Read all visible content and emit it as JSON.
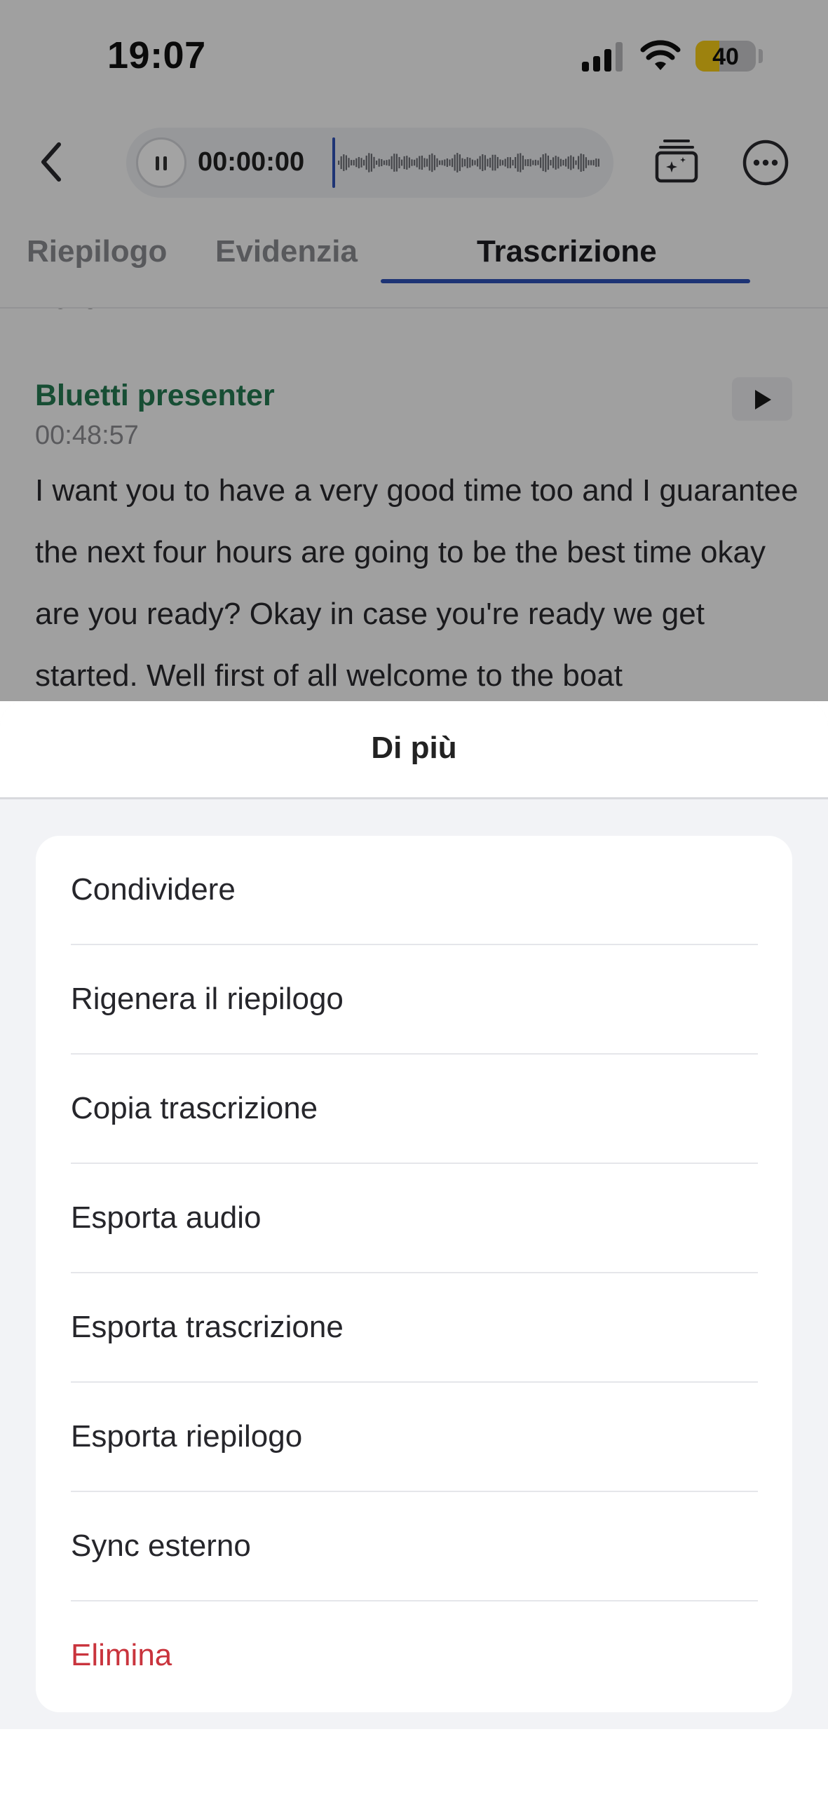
{
  "status_bar": {
    "time": "19:07",
    "battery_percent": "40",
    "battery_color": "#f6cc16"
  },
  "player": {
    "time": "00:00:00",
    "accent_color": "#2f52b8"
  },
  "tabs": [
    {
      "label": "Riepilogo",
      "selected": false
    },
    {
      "label": "Evidenzia",
      "selected": false
    },
    {
      "label": "Trascrizione",
      "selected": true
    }
  ],
  "transcript": {
    "previous_line": "hello.",
    "segment": {
      "speaker": "Bluetti presenter",
      "speaker_color": "#257a52",
      "timestamp": "00:48:57",
      "text": "I want you to have a very good time too and I guarantee the next four hours are going to be the best time okay are you ready? Okay in case you're ready we get started. Well first of all welcome to the boat"
    }
  },
  "sheet": {
    "title": "Di più",
    "items": [
      {
        "label": "Condividere",
        "danger": false
      },
      {
        "label": "Rigenera il riepilogo",
        "danger": false
      },
      {
        "label": "Copia trascrizione",
        "danger": false
      },
      {
        "label": "Esporta audio",
        "danger": false
      },
      {
        "label": "Esporta trascrizione",
        "danger": false
      },
      {
        "label": "Esporta riepilogo",
        "danger": false
      },
      {
        "label": "Sync esterno",
        "danger": false
      },
      {
        "label": "Elimina",
        "danger": true,
        "color": "#c9343d"
      }
    ]
  },
  "icons": [
    "back-icon",
    "pause-icon",
    "waveform",
    "cards-icon",
    "more-icon",
    "play-icon",
    "signal-icon",
    "wifi-icon",
    "battery-icon"
  ]
}
